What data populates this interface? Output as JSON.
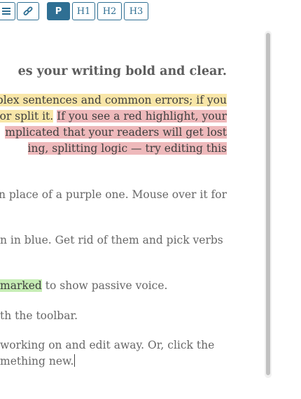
{
  "toolbar": {
    "list_icon": "list-icon",
    "link_icon": "link-icon",
    "p_label": "P",
    "h1_label": "H1",
    "h2_label": "H2",
    "h3_label": "H3"
  },
  "editor": {
    "heading": "es your writing bold and clear.",
    "p1": {
      "l1": "mplex sentences and common errors; if you",
      "l2a": "en or split it.",
      "l2b": "If you see a red highlight, your",
      "l3": "mplicated that your readers will get lost",
      "l4": "ing, splitting logic — try editing this"
    },
    "p2": {
      "l1": "rd in place of a purple one. Mouse over it for"
    },
    "p3": {
      "l1": "n in blue. Get rid of them and pick verbs"
    },
    "p4": {
      "l1a": "marked",
      "l1b": " to show passive voice."
    },
    "p5": {
      "l1": "th the toolbar."
    },
    "p6": {
      "l1": "working on and edit away. Or, click the",
      "l2": "mething new."
    }
  },
  "colors": {
    "accent": "#2f6f93",
    "complex_highlight": "#f8e6a8",
    "very_complex_highlight": "#eeb9bb",
    "passive_highlight": "#c6edb5"
  }
}
